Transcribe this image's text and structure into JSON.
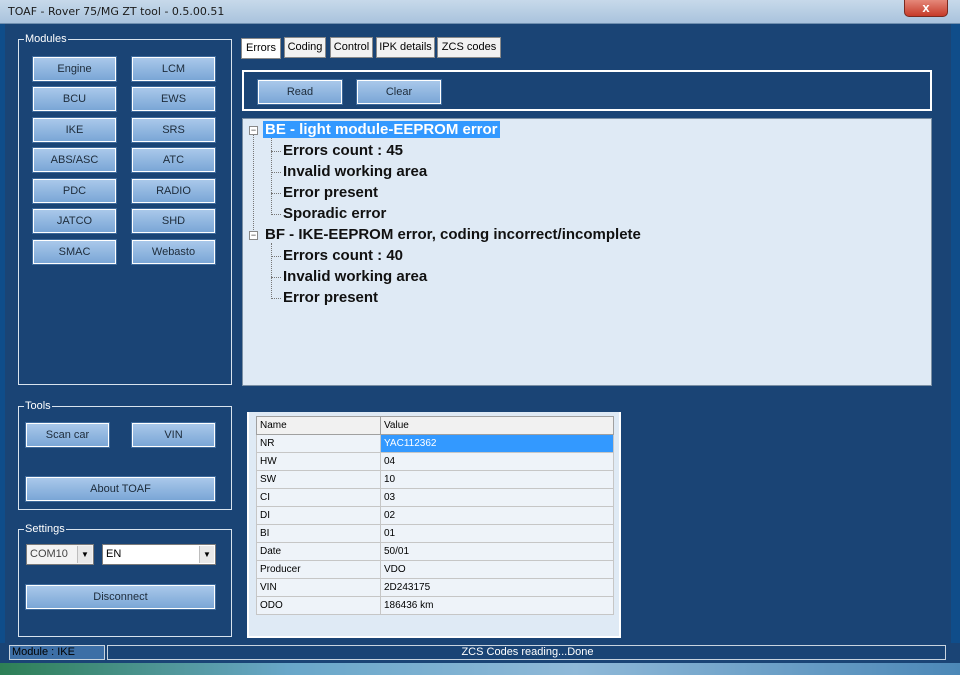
{
  "window": {
    "title": "TOAF - Rover 75/MG ZT tool - 0.5.00.51",
    "close_label": "x"
  },
  "modules": {
    "legend": "Modules",
    "buttons": [
      "Engine",
      "LCM",
      "BCU",
      "EWS",
      "IKE",
      "SRS",
      "ABS/ASC",
      "ATC",
      "PDC",
      "RADIO",
      "JATCO",
      "SHD",
      "SMAC",
      "Webasto"
    ]
  },
  "tools": {
    "legend": "Tools",
    "scan_car": "Scan car",
    "vin": "VIN",
    "about": "About TOAF"
  },
  "settings": {
    "legend": "Settings",
    "port_value": "COM10",
    "language_value": "EN",
    "disconnect": "Disconnect"
  },
  "tabs": [
    "Errors",
    "Coding",
    "Control",
    "IPK details",
    "ZCS codes"
  ],
  "actions": {
    "read": "Read",
    "clear": "Clear"
  },
  "errors_tree": [
    {
      "label": "BE - light module-EEPROM error",
      "children": [
        "Errors count : 45",
        "Invalid working area",
        "Error present",
        "Sporadic error"
      ]
    },
    {
      "label": "BF - IKE-EEPROM error, coding incorrect/incomplete",
      "children": [
        "Errors count : 40",
        "Invalid working area",
        "Error present"
      ]
    }
  ],
  "details_table": {
    "columns": [
      "Name",
      "Value"
    ],
    "rows": [
      [
        "NR",
        "YAC112362"
      ],
      [
        "HW",
        "04"
      ],
      [
        "SW",
        "10"
      ],
      [
        "CI",
        "03"
      ],
      [
        "DI",
        "02"
      ],
      [
        "BI",
        "01"
      ],
      [
        "Date",
        "50/01"
      ],
      [
        "Producer",
        "VDO"
      ],
      [
        "VIN",
        "2D243175"
      ],
      [
        "ODO",
        "186436 km"
      ]
    ]
  },
  "status": {
    "module": "Module : IKE",
    "message": "ZCS Codes reading...Done"
  },
  "colors": {
    "accent": "#3399ff",
    "background": "#1a4475",
    "button": "#7aa6d6"
  }
}
